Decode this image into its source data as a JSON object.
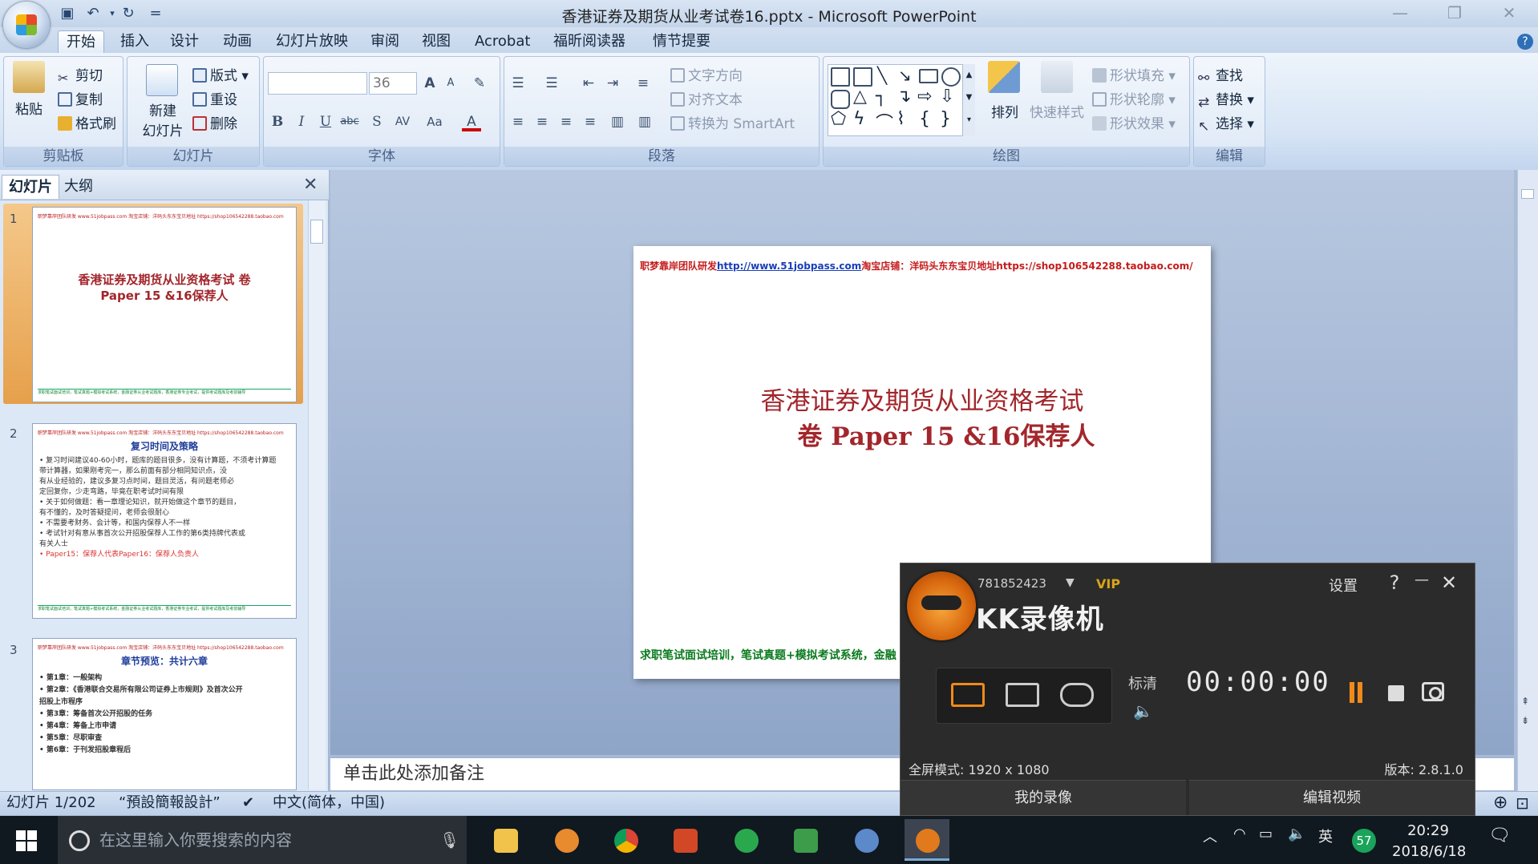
{
  "window": {
    "title": "香港证券及期货从业考试卷16.pptx - Microsoft PowerPoint",
    "qat_customize": "="
  },
  "tabs": [
    "开始",
    "插入",
    "设计",
    "动画",
    "幻灯片放映",
    "审阅",
    "视图",
    "Acrobat",
    "福昕阅读器",
    "情节提要"
  ],
  "ribbon": {
    "clipboard": {
      "paste": "粘贴",
      "cut": "剪切",
      "copy": "复制",
      "format_painter": "格式刷",
      "label": "剪贴板"
    },
    "slides": {
      "new_slide": "新建",
      "new_slide_2": "幻灯片",
      "layout": "版式",
      "reset": "重设",
      "delete": "删除",
      "label": "幻灯片"
    },
    "font": {
      "size": "36",
      "label": "字体",
      "bold": "B",
      "italic": "I",
      "underline": "U",
      "strike": "abc",
      "shadow": "S",
      "spacing": "AV",
      "case": "Aa",
      "color": "A",
      "grow": "A",
      "shrink": "A"
    },
    "paragraph": {
      "text_direction": "文字方向",
      "align_text": "对齐文本",
      "smartart": "转换为 SmartArt",
      "label": "段落"
    },
    "drawing": {
      "arrange": "排列",
      "quick_styles": "快速样式",
      "shape_fill": "形状填充",
      "shape_outline": "形状轮廓",
      "shape_effects": "形状效果",
      "label": "绘图"
    },
    "editing": {
      "find": "查找",
      "replace": "替换",
      "select": "选择",
      "label": "编辑"
    }
  },
  "panel": {
    "tab_slides": "幻灯片",
    "tab_outline": "大纲",
    "thumbs": [
      {
        "num": "1",
        "title": "香港证券及期货从业资格考试 卷 Paper 15 &16保荐人"
      },
      {
        "num": "2",
        "title": "复习时间及策略",
        "bullets": [
          "• 复习时间建议40-60小时，题库的题目很多，没有计算题，不须考计算题",
          "  带计算器，如果刚考完一，那么前面有部分相同知识点，没",
          "  有从业经验的，建议多复习点时间，题目灵活，有问题老师必",
          "  定回复你，少走弯路，毕竟在职考试时间有限",
          "• 关于如何做题：看一章理论知识，就开始做这个章节的题目，",
          "  有不懂的，及时答疑提问，老师会很耐心",
          "• 不需要考财务、会计等，和国内保荐人不一样",
          "• 考试针对有意从事首次公开招股保荐人工作的第6类持牌代表或",
          "  有关人士",
          "• Paper15：保荐人代表Paper16：保荐人负责人"
        ]
      },
      {
        "num": "3",
        "title": "章节预览：共计六章",
        "bullets": [
          "• 第1章：一般架构",
          "• 第2章：《香港联合交易所有限公司证券上市规则》及首次公开",
          "  招股上市程序",
          "• 第3章：筹备首次公开招股的任务",
          "• 第4章：筹备上市申请",
          "• 第5章：尽职审查",
          "• 第6章：于刊发招股章程后"
        ]
      }
    ],
    "thumb_header": "职梦靠岸团队研发 www.51jobpass.com 淘宝店铺：洋码头东东宝贝地址 https://shop106542288.taobao.com",
    "thumb_footer": "求职笔试面试培训，笔试真题+模拟考试系统，金融证券从业考试题库，香港证券专业考试，提供考试题库及考前辅导"
  },
  "slide": {
    "header_prefix": "职梦靠岸团队研发",
    "header_link": "http://www.51jobpass.com",
    "header_suffix": "淘宝店铺：洋码头东东宝贝地址https://shop106542288.taobao.com/",
    "title_line1": "香港证券及期货从业资格考试",
    "title_line2": "卷 Paper 15 &16保荐人",
    "footer": "求职笔试面试培训，笔试真题+模拟考试系统，金融"
  },
  "notes_placeholder": "单击此处添加备注",
  "status": {
    "slide": "幻灯片 1/202",
    "theme": "“預設簡報設計”",
    "language": "中文(简体，中国)"
  },
  "kk": {
    "user": "781852423",
    "vip": "VIP",
    "title": "KK录像机",
    "settings": "设置",
    "help": "?",
    "minimize": "—",
    "close": "✕",
    "quality": "标清",
    "timer": "00:00:00",
    "mode": "全屏模式: 1920 x 1080",
    "version": "版本: 2.8.1.0",
    "my_recordings": "我的录像",
    "edit_video": "编辑视频"
  },
  "taskbar": {
    "search_placeholder": "在这里输入你要搜索的内容",
    "ime": "英",
    "badge": "57",
    "time": "20:29",
    "date": "2018/6/18"
  }
}
